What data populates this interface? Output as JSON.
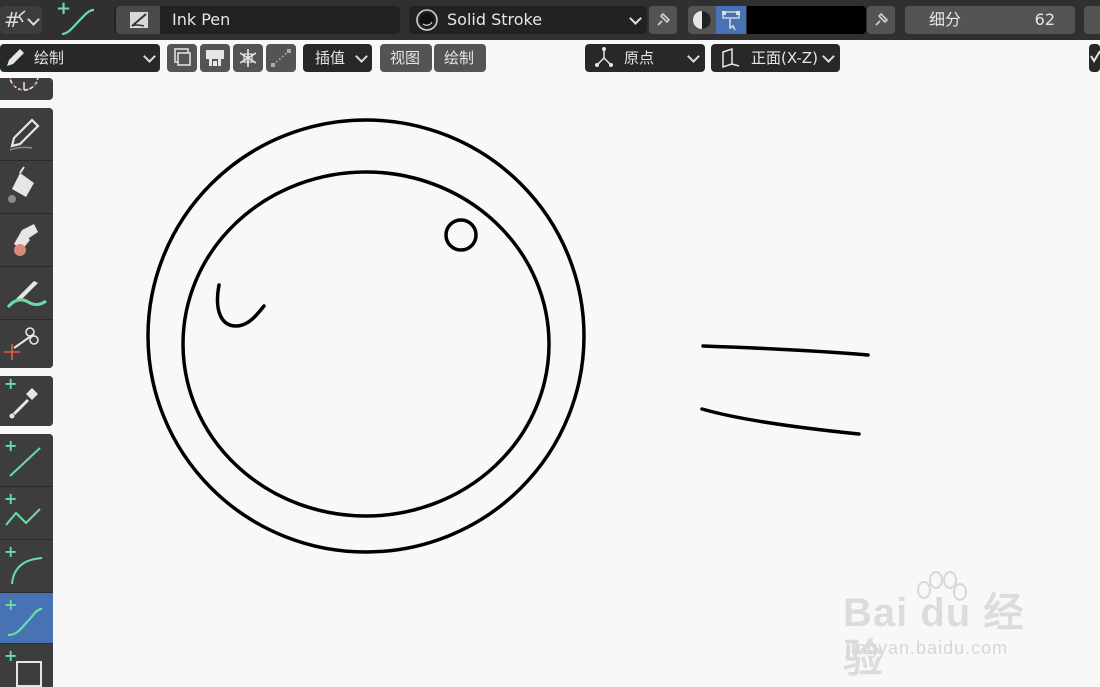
{
  "header": {
    "brush_name": "Ink Pen",
    "stroke_material": "Solid Stroke",
    "subdivision_label": "细分",
    "subdivision_value": "62",
    "color_swatch": "#000000",
    "icons": [
      "grid-snap-icon",
      "curve-draw-tool-icon",
      "brush-icon",
      "material-sphere-icon",
      "pin-icon",
      "vertex-color-icon",
      "color-attribute-icon"
    ]
  },
  "toolbar": {
    "mode_label": "绘制",
    "interpolate_label": "插值",
    "view_menu": "视图",
    "draw_menu": "绘制",
    "origin_label": "原点",
    "plane_label": "正面(X-Z)"
  },
  "left_tools": [
    {
      "name": "draw-tool",
      "icon": "pencil-icon"
    },
    {
      "name": "fill-tool",
      "icon": "paint-bucket-icon"
    },
    {
      "name": "erase-tool",
      "icon": "eraser-icon"
    },
    {
      "name": "tint-tool",
      "icon": "tint-brush-icon"
    },
    {
      "name": "cutter-tool",
      "icon": "scissors-icon"
    },
    {
      "name": "eyedropper-tool",
      "icon": "eyedropper-icon"
    },
    {
      "name": "line-tool",
      "icon": "line-icon"
    },
    {
      "name": "polyline-tool",
      "icon": "polyline-icon"
    },
    {
      "name": "arc-tool",
      "icon": "arc-icon"
    },
    {
      "name": "curve-tool",
      "icon": "curve-icon",
      "active": true
    },
    {
      "name": "box-tool",
      "icon": "box-icon"
    }
  ],
  "colors": {
    "accent": "#4772b3",
    "header_bg": "#303030",
    "canvas_bg": "#f8f8f8",
    "tool_green": "#6bdca8"
  },
  "watermark": {
    "logo_text": "Bai du 经验",
    "url": "jingyan.baidu.com"
  }
}
